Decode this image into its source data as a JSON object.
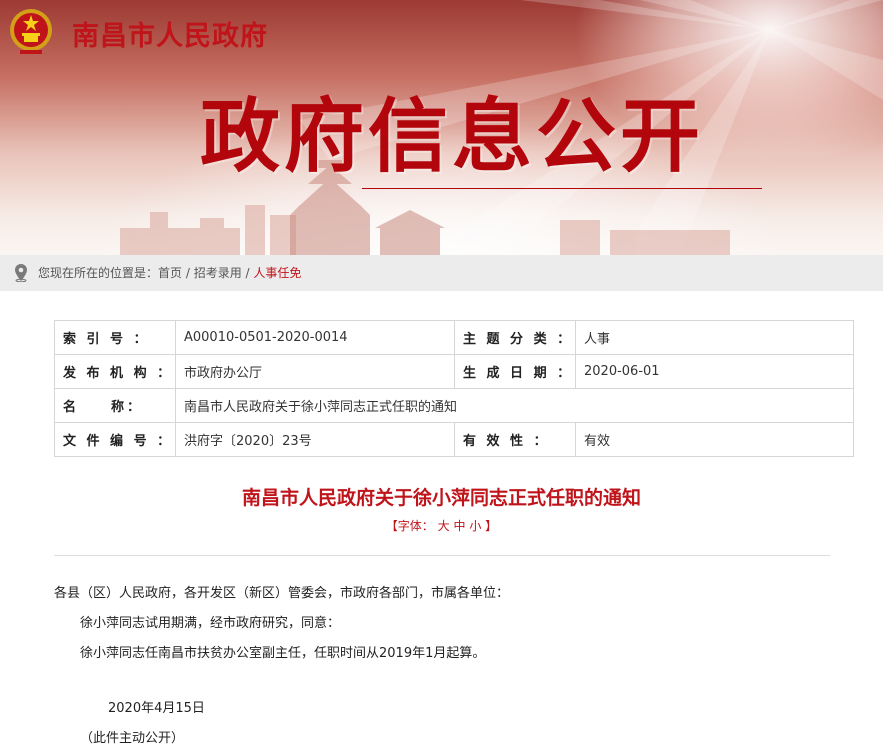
{
  "header": {
    "site_title": "南昌市人民政府",
    "banner_title": "政府信息公开"
  },
  "breadcrumb": {
    "prefix": "您现在所在的位置是：",
    "items": [
      "首页",
      "招考录用",
      "人事任免"
    ],
    "separator": " / "
  },
  "meta": {
    "index_label": "索 引 号 ：",
    "index_value": "A00010-0501-2020-0014",
    "category_label": "主 题 分 类 ：",
    "category_value": "人事",
    "publisher_label": "发 布 机 构 ：",
    "publisher_value": "市政府办公厅",
    "date_label": "生 成 日 期 ：",
    "date_value": "2020-06-01",
    "name_label": "名　　称：",
    "name_value": "南昌市人民政府关于徐小萍同志正式任职的通知",
    "docno_label": "文 件 编 号 ：",
    "docno_value": "洪府字〔2020〕23号",
    "validity_label": "有 效 性 ：",
    "validity_value": "有效"
  },
  "article": {
    "title": "南昌市人民政府关于徐小萍同志正式任职的通知",
    "font_prefix": "【字体：",
    "font_large": "大",
    "font_medium": "中",
    "font_small": "小",
    "font_suffix": "】",
    "p1": "各县（区）人民政府，各开发区（新区）管委会，市政府各部门，市属各单位：",
    "p2": "徐小萍同志试用期满，经市政府研究，同意：",
    "p3": "徐小萍同志任南昌市扶贫办公室副主任，任职时间从2019年1月起算。",
    "date": "2020年4月15日",
    "note": "（此件主动公开）"
  },
  "colors": {
    "brand_red": "#c0141b",
    "title_red": "#b3060c",
    "breadcrumb_bg": "#ececec"
  },
  "icons": {
    "emblem": "national-emblem-icon",
    "location": "location-pin-icon"
  }
}
